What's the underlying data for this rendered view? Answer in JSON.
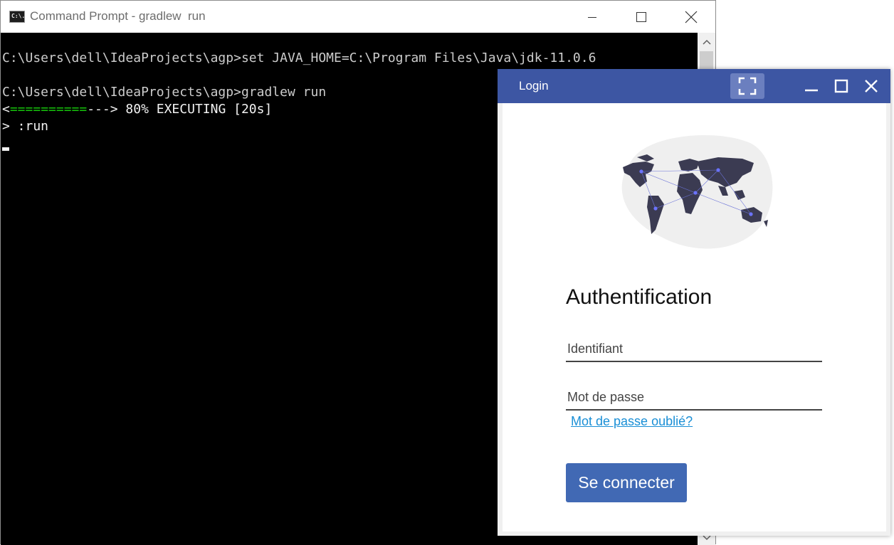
{
  "cmd": {
    "icon_text": "C:\\.",
    "title": "Command Prompt - gradlew  run",
    "lines": {
      "line1": "C:\\Users\\dell\\IdeaProjects\\agp>set JAVA_HOME=C:\\Program Files\\Java\\jdk-11.0.6",
      "line2": "C:\\Users\\dell\\IdeaProjects\\agp>gradlew run",
      "progress_start": "<",
      "progress_bar": "==========",
      "progress_rest": "--->",
      "progress_status": " 80% EXECUTING [20s]",
      "task": "> :run"
    },
    "progress_fraction": 0.8
  },
  "login": {
    "title": "Login",
    "heading": "Authentification",
    "username_placeholder": "Identifiant",
    "password_placeholder": "Mot de passe",
    "forgot_link": "Mot de passe oublié?",
    "submit_label": "Se connecter"
  },
  "colors": {
    "titlebar": "#3d56a3",
    "button": "#4169b4",
    "link": "#1a8fd6",
    "progress": "#16c60c"
  },
  "icons": {
    "fullscreen": "fullscreen-icon",
    "minimize": "minimize-icon",
    "maximize": "maximize-icon",
    "close": "close-icon"
  }
}
